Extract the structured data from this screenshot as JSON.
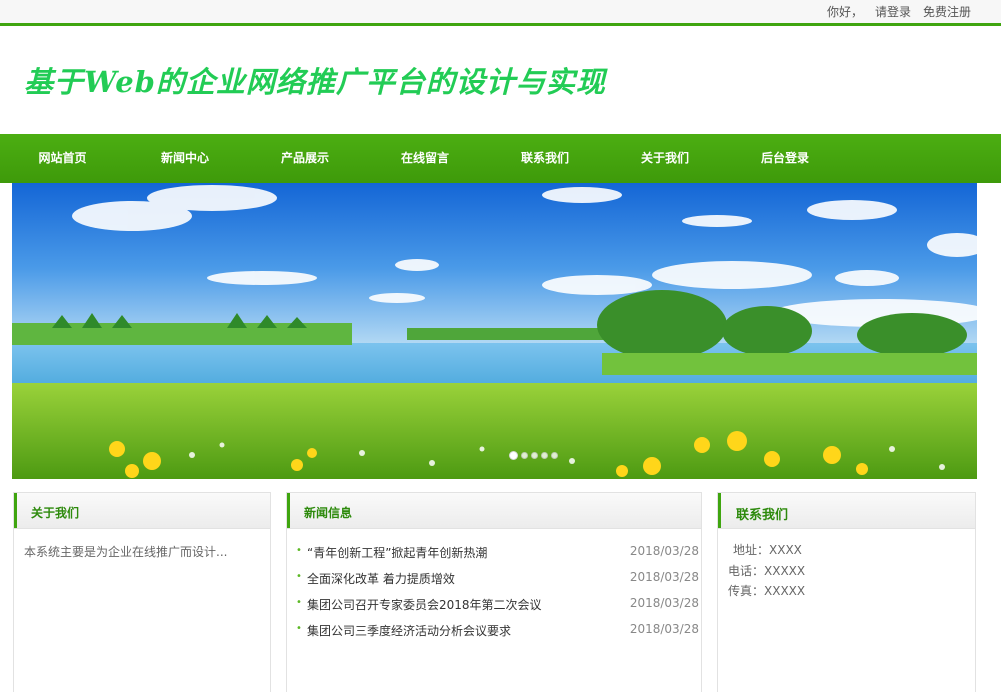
{
  "topbar": {
    "greeting": "你好，",
    "login": "请登录",
    "register": "免费注册"
  },
  "header": {
    "title": "基于Web的企业网络推广平台的设计与实现"
  },
  "nav": {
    "items": [
      {
        "label": "网站首页"
      },
      {
        "label": "新闻中心"
      },
      {
        "label": "产品展示"
      },
      {
        "label": "在线留言"
      },
      {
        "label": "联系我们"
      },
      {
        "label": "关于我们"
      },
      {
        "label": "后台登录"
      }
    ]
  },
  "banner": {
    "slide_count": 5,
    "active_slide": 0
  },
  "about": {
    "heading": "关于我们",
    "text": "本系统主要是为企业在线推广而设计..."
  },
  "news": {
    "heading": "新闻信息",
    "items": [
      {
        "title": "“青年创新工程”掀起青年创新热潮",
        "date": "2018/03/28"
      },
      {
        "title": "全面深化改革 着力提质增效",
        "date": "2018/03/28"
      },
      {
        "title": "集团公司召开专家委员会2018年第二次会议",
        "date": "2018/03/28"
      },
      {
        "title": "集团公司三季度经济活动分析会议要求",
        "date": "2018/03/28"
      }
    ]
  },
  "contact": {
    "heading": "联系我们",
    "address": "地址：XXXX",
    "phone": "电话：XXXXX",
    "fax": "传真：XXXXX"
  },
  "colors": {
    "accent": "#3fa50f",
    "title": "#22cc55",
    "nav": "#4cae12"
  }
}
